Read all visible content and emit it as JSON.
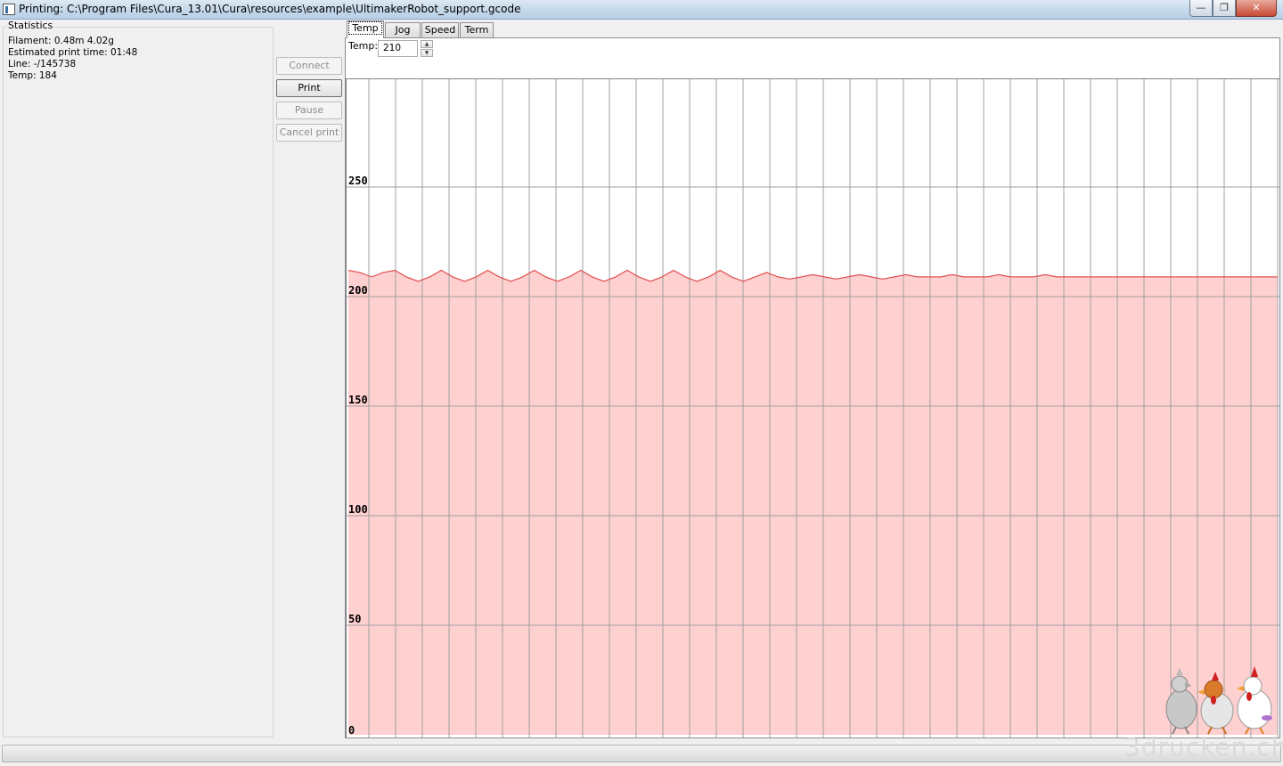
{
  "window": {
    "title": "Printing: C:\\Program Files\\Cura_13.01\\Cura\\resources\\example\\UltimakerRobot_support.gcode",
    "min_glyph": "—",
    "max_glyph": "❐",
    "close_glyph": "✕"
  },
  "statistics": {
    "legend": "Statistics",
    "filament": "Filament: 0.48m 4.02g",
    "time": "Estimated print time: 01:48",
    "line": "Line: -/145738",
    "temp": "Temp: 184"
  },
  "buttons": {
    "connect": "Connect",
    "print": "Print",
    "pause": "Pause",
    "cancel": "Cancel print"
  },
  "tabs": [
    {
      "label": "Temp",
      "selected": true
    },
    {
      "label": "Jog"
    },
    {
      "label": "Speed"
    },
    {
      "label": "Term"
    }
  ],
  "temp_control": {
    "label": "Temp:",
    "value": "210",
    "up_glyph": "▲",
    "down_glyph": "▼"
  },
  "chart_data": {
    "type": "area",
    "ylim": [
      0,
      300
    ],
    "yticks": [
      "0",
      "50",
      "100",
      "150",
      "200",
      "250"
    ],
    "grid": true,
    "colors": {
      "fill": "#ffd0d0",
      "line": "#e05050",
      "grid": "#a0a0a0"
    },
    "series": [
      {
        "x": [
          0,
          1,
          2,
          3,
          4,
          5,
          6,
          7,
          8,
          9,
          10,
          11,
          12,
          13,
          14,
          15,
          16,
          17,
          18,
          19,
          20,
          21,
          22,
          23,
          24,
          25,
          26,
          27,
          28,
          29,
          30,
          31,
          32,
          33,
          34,
          35,
          36,
          37,
          38,
          39,
          40,
          41,
          42,
          43,
          44,
          45,
          46,
          47,
          48,
          49,
          50,
          51,
          52,
          53,
          54,
          55,
          56,
          57,
          58,
          59,
          60,
          61,
          62,
          63,
          64,
          65,
          66,
          67,
          68,
          69,
          70,
          71,
          72,
          73,
          74,
          75,
          76,
          77,
          78,
          79,
          80
        ],
        "values": [
          212,
          211,
          209,
          211,
          212,
          209,
          207,
          209,
          212,
          209,
          207,
          209,
          212,
          209,
          207,
          209,
          212,
          209,
          207,
          209,
          212,
          209,
          207,
          209,
          212,
          209,
          207,
          209,
          212,
          209,
          207,
          209,
          212,
          209,
          207,
          209,
          211,
          209,
          208,
          209,
          210,
          209,
          208,
          209,
          210,
          209,
          208,
          209,
          210,
          209,
          209,
          209,
          210,
          209,
          209,
          209,
          210,
          209,
          209,
          209,
          210,
          209,
          209,
          209,
          209,
          209,
          209,
          209,
          209,
          209,
          209,
          209,
          209,
          209,
          209,
          209,
          209,
          209,
          209,
          209,
          209
        ]
      }
    ]
  },
  "progress": {
    "value": 0
  },
  "watermark": "3drucken.ch",
  "mascot": "chicken-mascots"
}
